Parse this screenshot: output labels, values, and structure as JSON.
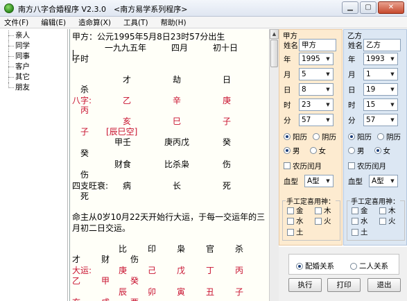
{
  "window": {
    "title": "南方八字合婚程序 V2.3.0　<南方易学系列程序>",
    "minimize": "▁",
    "maximize": "▢",
    "close": "✕"
  },
  "menu": [
    "文件(F)",
    "编辑(E)",
    "造命算(X)",
    "工具(T)",
    "帮助(H)"
  ],
  "nav": [
    "亲人",
    "同学",
    "同事",
    "客户",
    "其它",
    "朋友"
  ],
  "chart": {
    "line1": "甲方：公元1995年5月8日23时57分出生",
    "line2": "一九九五年　　　四月　　　初十日",
    "line3": "子时",
    "shishen_top": [
      "才",
      "劫",
      "日"
    ],
    "shishen_top_last": "杀",
    "bazi_label": "八字:",
    "bazi_gan": [
      "乙",
      "辛",
      "庚"
    ],
    "bazi_last": "丙",
    "bazi_zhi": [
      "亥",
      "巳",
      "子"
    ],
    "zi": "子",
    "kong": "[辰巳空]",
    "canggan": [
      "甲壬",
      "庚丙戊",
      "癸"
    ],
    "canggan_last": "癸",
    "canggan_shen": [
      "财食",
      "比杀枭",
      "伤"
    ],
    "canggan_shen_last": "伤",
    "wangshuai_label": "四支旺衰:",
    "wangshuai": [
      "病",
      "长",
      "死"
    ],
    "wangshuai_last": "死",
    "dayun_text1": "命主从0岁10月22天开始行大运，于每一交运年的三",
    "dayun_text2": "月初二日交运。",
    "dayun_shen": [
      "比",
      "印",
      "枭",
      "官",
      "杀"
    ],
    "dayun_shen2": [
      "才",
      "财",
      "伤"
    ],
    "dayun_label": "大运:",
    "dayun_gan": [
      "庚",
      "己",
      "戊",
      "丁",
      "丙"
    ],
    "dayun_gan2": [
      "乙",
      "甲",
      "癸"
    ],
    "dayun_zhi": [
      "辰",
      "卯",
      "寅",
      "丑",
      "子"
    ],
    "dayun_zhi2": [
      "亥",
      "戌",
      "酉"
    ]
  },
  "party_a": {
    "title": "甲方",
    "name_label": "姓名",
    "name": "甲方",
    "year_label": "年",
    "year": "1995",
    "month_label": "月",
    "month": "5",
    "day_label": "日",
    "day": "8",
    "hour_label": "时",
    "hour": "23",
    "minute_label": "分",
    "minute": "57",
    "solar": "阳历",
    "lunar": "阴历",
    "male": "男",
    "female": "女",
    "leap": "农历闰月",
    "blood_label": "血型",
    "blood": "A型",
    "xiyong_title": "手工定喜用神：",
    "jin": "金",
    "mu": "木",
    "shui": "水",
    "huo": "火",
    "tu": "土",
    "calendar_selected": "solar",
    "gender_selected": "male"
  },
  "party_b": {
    "title": "乙方",
    "name_label": "姓名",
    "name": "乙方",
    "year_label": "年",
    "year": "1993",
    "month_label": "月",
    "month": "1",
    "day_label": "日",
    "day": "19",
    "hour_label": "时",
    "hour": "15",
    "minute_label": "分",
    "minute": "57",
    "solar": "阳历",
    "lunar": "阴历",
    "male": "男",
    "female": "女",
    "leap": "农历闰月",
    "blood_label": "血型",
    "blood": "A型",
    "xiyong_title": "手工定喜用神：",
    "jin": "金",
    "mu": "木",
    "shui": "水",
    "huo": "火",
    "tu": "土",
    "calendar_selected": "solar",
    "gender_selected": "female"
  },
  "relation": {
    "marriage": "配婚关系",
    "two_person": "二人关系",
    "selected": "marriage"
  },
  "buttons": {
    "run": "执行",
    "print": "打印",
    "exit": "退出"
  },
  "colors": {
    "red_text": "#c8102e",
    "panel_a_bg": "#fdebd0",
    "panel_b_bg": "#dce7f3"
  },
  "icons": {
    "app": "app-icon",
    "dropdown": "chevron-down-icon",
    "scroll_up": "arrow-up-icon"
  }
}
